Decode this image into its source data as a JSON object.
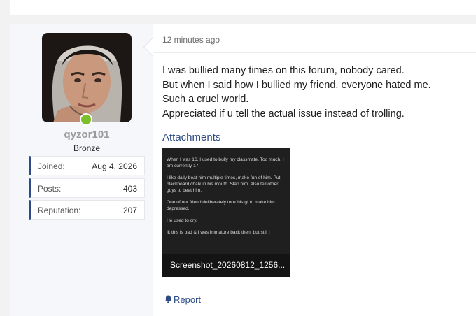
{
  "user": {
    "username": "qyzor101",
    "title": "Bronze",
    "online_status_color": "#7bbf2a",
    "stats": [
      {
        "label": "Joined:",
        "value": "Aug 4, 2026"
      },
      {
        "label": "Posts:",
        "value": "403"
      },
      {
        "label": "Reputation:",
        "value": "207"
      }
    ]
  },
  "post": {
    "timestamp": "12 minutes ago",
    "lines": [
      "I was bullied many times on this forum, nobody cared.",
      "But when I said how I bullied my friend, everyone hated me.",
      "Such a cruel world.",
      "Appreciated if u tell the actual issue instead of trolling."
    ],
    "attachments_heading": "Attachments",
    "attachment": {
      "filename": "Screenshot_20260812_1256...",
      "preview_paragraphs": [
        "When I was 16, I used to bully my classmate. Too much. I am currently 17.",
        "I like daily beat him multiple times, make fun of him. Put blackboard chalk in his mouth. Slap him. Also tell other guys to beat him.",
        "One of our friend deliberately took his gf to make him depressed.",
        "He used to cry.",
        "Ik this is bad & I was immature back then, but still I"
      ]
    },
    "report_label": "Report"
  },
  "colors": {
    "accent": "#2b4a86",
    "username": "#9a9a9a"
  }
}
